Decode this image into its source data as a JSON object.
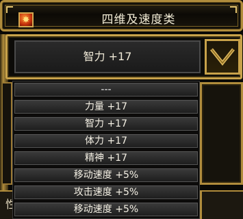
{
  "window": {
    "title": "四维及速度类",
    "icon": "fire-emblem-icon"
  },
  "combo": {
    "selected": "智力 +17"
  },
  "dropdown": {
    "options": [
      {
        "label": "---"
      },
      {
        "label": "力量 +17"
      },
      {
        "label": "智力 +17"
      },
      {
        "label": "体力 +17"
      },
      {
        "label": "精神 +17"
      },
      {
        "label": "移动速度 +5%"
      },
      {
        "label": "攻击速度 +5%"
      },
      {
        "label": "移动速度 +5%"
      }
    ]
  },
  "background": {
    "left_fragment": "性"
  },
  "colors": {
    "gold": "#c8a24a",
    "text": "#f0ead8"
  }
}
